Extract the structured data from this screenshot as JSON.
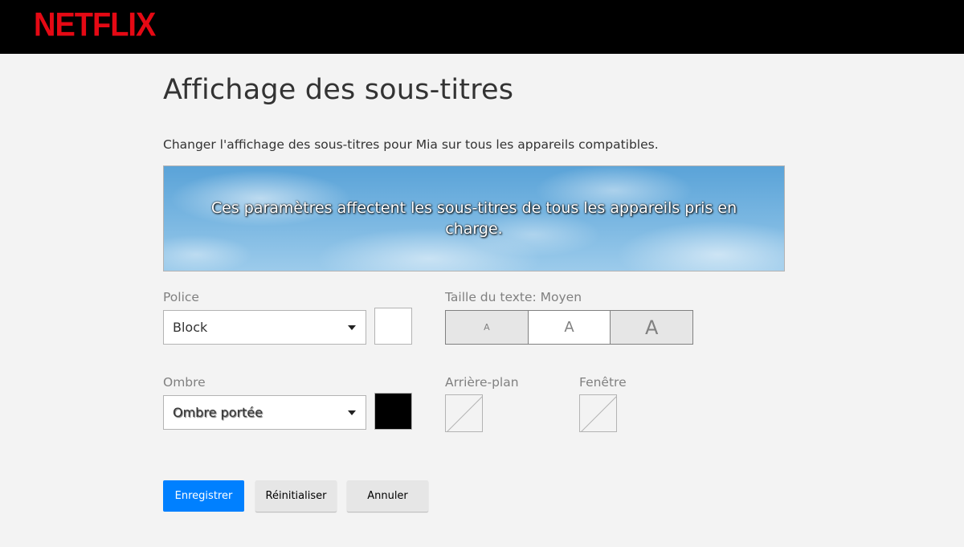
{
  "header": {
    "logo_text": "NETFLIX",
    "brand_color": "#e50914"
  },
  "page": {
    "title": "Affichage des sous-titres",
    "description": "Changer l'affichage des sous-titres pour Mia sur tous les appareils compatibles."
  },
  "preview": {
    "text": "Ces paramètres affectent les sous-titres de tous les appareils pris en charge."
  },
  "font": {
    "label": "Police",
    "selected": "Block",
    "color": "#ffffff"
  },
  "text_size": {
    "label": "Taille du texte: Moyen",
    "options": [
      "A",
      "A",
      "A"
    ],
    "selected_index": 1
  },
  "shadow": {
    "label": "Ombre",
    "selected": "Ombre portée",
    "color": "#000000"
  },
  "background": {
    "label": "Arrière-plan",
    "color": "none"
  },
  "window": {
    "label": "Fenêtre",
    "color": "none"
  },
  "actions": {
    "save": "Enregistrer",
    "reset": "Réinitialiser",
    "cancel": "Annuler",
    "primary_color": "#0080ff"
  }
}
